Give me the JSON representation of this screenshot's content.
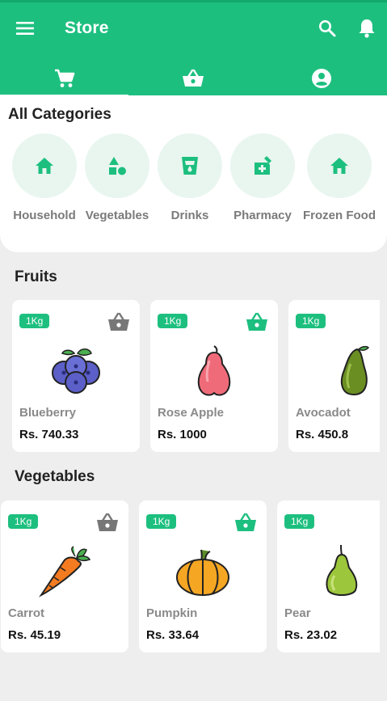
{
  "appbar": {
    "title": "Store",
    "color": "#1dbf7f"
  },
  "tabs": [
    {
      "name": "cart-icon"
    },
    {
      "name": "basket-icon"
    },
    {
      "name": "account-icon"
    }
  ],
  "categories": {
    "title": "All Categories",
    "items": [
      {
        "label": "Household",
        "icon": "home-icon"
      },
      {
        "label": "Vegetables",
        "icon": "shapes-icon"
      },
      {
        "label": "Drinks",
        "icon": "cup-icon"
      },
      {
        "label": "Pharmacy",
        "icon": "medical-bag-icon"
      },
      {
        "label": "Frozen Food",
        "icon": "home-icon"
      }
    ]
  },
  "fruits": {
    "title": "Fruits",
    "items": [
      {
        "badge": "1Kg",
        "name": "Blueberry",
        "price": "Rs. 740.33",
        "in_basket": false
      },
      {
        "badge": "1Kg",
        "name": "Rose Apple",
        "price": "Rs. 1000",
        "in_basket": true
      },
      {
        "badge": "1Kg",
        "name": "Avocadot",
        "price": "Rs. 450.8",
        "in_basket": false
      }
    ]
  },
  "vegetables": {
    "title": "Vegetables",
    "items": [
      {
        "badge": "1Kg",
        "name": "Carrot",
        "price": "Rs. 45.19",
        "in_basket": false
      },
      {
        "badge": "1Kg",
        "name": "Pumpkin",
        "price": "Rs. 33.64",
        "in_basket": true
      },
      {
        "badge": "1Kg",
        "name": "Pear",
        "price": "Rs. 23.02",
        "in_basket": false
      }
    ]
  }
}
